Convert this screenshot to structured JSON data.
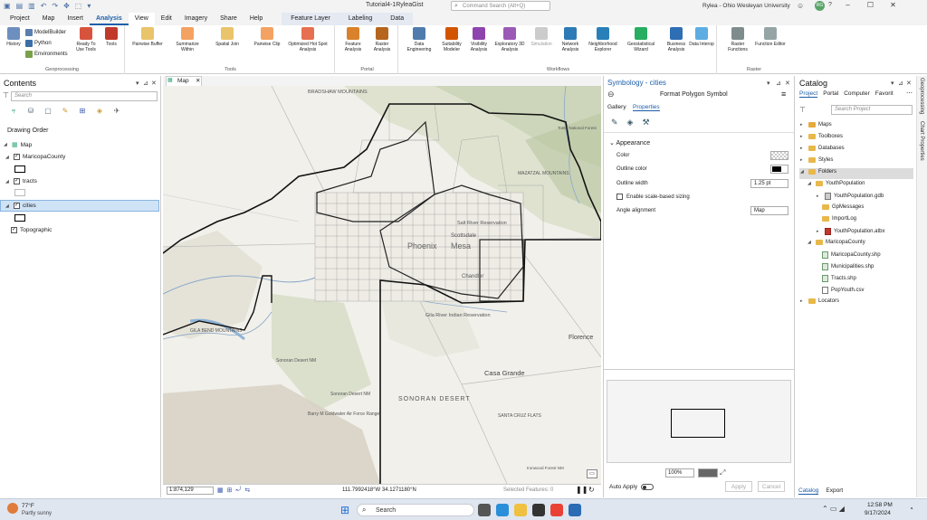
{
  "titlebar": {
    "doc_title": "Tutorial4-1RyleaGist",
    "search_placeholder": "Command Search (Alt+Q)",
    "user": "Rylea - Ohio Wesleyan University",
    "initials": "RG",
    "help": "?"
  },
  "tabs": [
    "Project",
    "Map",
    "Insert",
    "Analysis",
    "View",
    "Edit",
    "Imagery",
    "Share",
    "Help",
    "Feature Layer",
    "Labeling",
    "Data"
  ],
  "active_tab": "Analysis",
  "ribbon": {
    "geoprocessing": {
      "label": "Geoprocessing",
      "history": "History",
      "modelbuilder": "ModelBuilder",
      "python": "Python",
      "environments": "Environments",
      "ready_to_use": "Ready To Use Tools",
      "tools": "Tools"
    },
    "tools_group": {
      "label": "Tools",
      "items": [
        "Pairwise Buffer",
        "Summarize Within",
        "Spatial Join",
        "Pairwise Clip",
        "Optimized Hot Spot Analysis"
      ]
    },
    "portal": {
      "label": "Portal",
      "items": [
        "Feature Analysis",
        "Raster Analysis"
      ]
    },
    "workflows": {
      "label": "Workflows",
      "items": [
        "Data Engineering",
        "Suitability Modeler",
        "Visibility Analysis",
        "Exploratory 3D Analysis",
        "Simulation",
        "Network Analysis",
        "Neighborhood Explorer",
        "Geostatistical Wizard",
        "Business Analysis",
        "Data Interop"
      ]
    },
    "raster": {
      "label": "Raster",
      "items": [
        "Raster Functions",
        "Function Editor"
      ]
    }
  },
  "contents": {
    "title": "Contents",
    "search_placeholder": "Search",
    "drawing_order": "Drawing Order",
    "layers": [
      {
        "name": "Map",
        "checked": null
      },
      {
        "name": "MaricopaCounty",
        "checked": true
      },
      {
        "name": "tracts",
        "checked": true
      },
      {
        "name": "cities",
        "checked": true
      },
      {
        "name": "Topographic",
        "checked": true
      }
    ]
  },
  "map": {
    "tab_label": "Map",
    "labels": [
      "Phoenix",
      "Mesa",
      "Scottsdale",
      "Chandler",
      "Salt River Reservation",
      "Gila River Indian Reservation",
      "Sonoran Desert NM",
      "SONORAN DESERT",
      "Casa Grande",
      "Florence",
      "GILA BEND MOUNTAINS",
      "MAZATZAL MOUNTAINS",
      "SANTA CRUZ FLATS",
      "Barry M Goldwater Air Force Range",
      "Sonoran Desert NM",
      "Ironwood Forest NM",
      "BRADSHAW MOUNTAINS",
      "Tonto National Forest"
    ],
    "scale": "1:874,129",
    "coords": "111.7992418°W 34.1271180°N",
    "selected_features": "Selected Features: 0"
  },
  "symbology": {
    "title": "Symbology - cities",
    "subtitle": "Format Polygon Symbol",
    "tabs": [
      "Gallery",
      "Properties"
    ],
    "active_tab": "Properties",
    "section": "Appearance",
    "color_label": "Color",
    "outline_color_label": "Outline color",
    "outline_width_label": "Outline width",
    "outline_width_value": "1.25 pt",
    "scale_sizing_label": "Enable scale-based sizing",
    "angle_label": "Angle alignment",
    "angle_value": "Map",
    "zoom": "100%",
    "auto_apply": "Auto Apply",
    "apply": "Apply",
    "cancel": "Cancel"
  },
  "catalog": {
    "title": "Catalog",
    "tabs": [
      "Project",
      "Portal",
      "Computer",
      "Favorit"
    ],
    "search_placeholder": "Search Project",
    "items": [
      {
        "label": "Maps",
        "level": 0
      },
      {
        "label": "Toolboxes",
        "level": 0
      },
      {
        "label": "Databases",
        "level": 0
      },
      {
        "label": "Styles",
        "level": 0
      },
      {
        "label": "Folders",
        "level": 0
      },
      {
        "label": "YouthPopulation",
        "level": 1
      },
      {
        "label": "YouthPopulation.gdb",
        "level": 2
      },
      {
        "label": "GpMessages",
        "level": 2
      },
      {
        "label": "ImportLog",
        "level": 2
      },
      {
        "label": "YouthPopulation.atbx",
        "level": 2
      },
      {
        "label": "MaricopaCounty",
        "level": 1
      },
      {
        "label": "MaricopaCounty.shp",
        "level": 2
      },
      {
        "label": "Municipalities.shp",
        "level": 2
      },
      {
        "label": "Tracts.shp",
        "level": 2
      },
      {
        "label": "PopYouth.csv",
        "level": 2
      },
      {
        "label": "Locators",
        "level": 0
      }
    ],
    "bottom_tabs": [
      "Catalog",
      "Export"
    ],
    "side_tabs": [
      "Geoprocessing",
      "Chart Properties"
    ]
  },
  "taskbar": {
    "weather_temp": "77°F",
    "weather_desc": "Partly sunny",
    "search": "Search",
    "time": "12:58 PM",
    "date": "9/17/2024"
  }
}
